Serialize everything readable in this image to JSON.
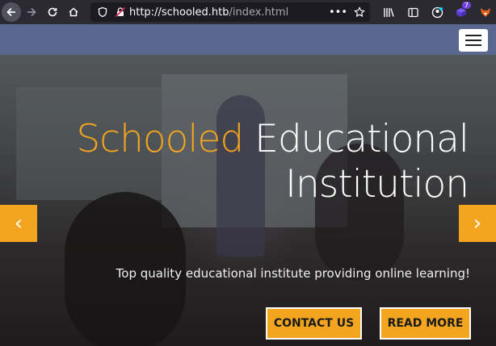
{
  "browser": {
    "url_host": "http://schooled.htb",
    "url_path": "/index.html",
    "icons": {
      "back": "back-arrow-icon",
      "forward": "forward-arrow-icon",
      "reload": "reload-icon",
      "home": "home-icon",
      "shield": "shield-icon",
      "insecure": "insecure-lock-icon",
      "more": "more-dots-icon",
      "bookmark": "star-icon",
      "library": "library-icon",
      "sidebar": "sidebar-icon",
      "account": "account-icon",
      "extension_badge": "7"
    }
  },
  "hero": {
    "title_accent": "Schooled",
    "title_rest": "Educational",
    "title_line2": "Institution",
    "subtitle": "Top quality educational institute providing online learning!",
    "contact_label": "CONTACT US",
    "read_more_label": "READ MORE",
    "prev_arrow": "‹",
    "next_arrow": "›"
  },
  "colors": {
    "accent": "#f3a51f",
    "navbar": "#5a6890",
    "toolbar": "#2b2a33"
  }
}
